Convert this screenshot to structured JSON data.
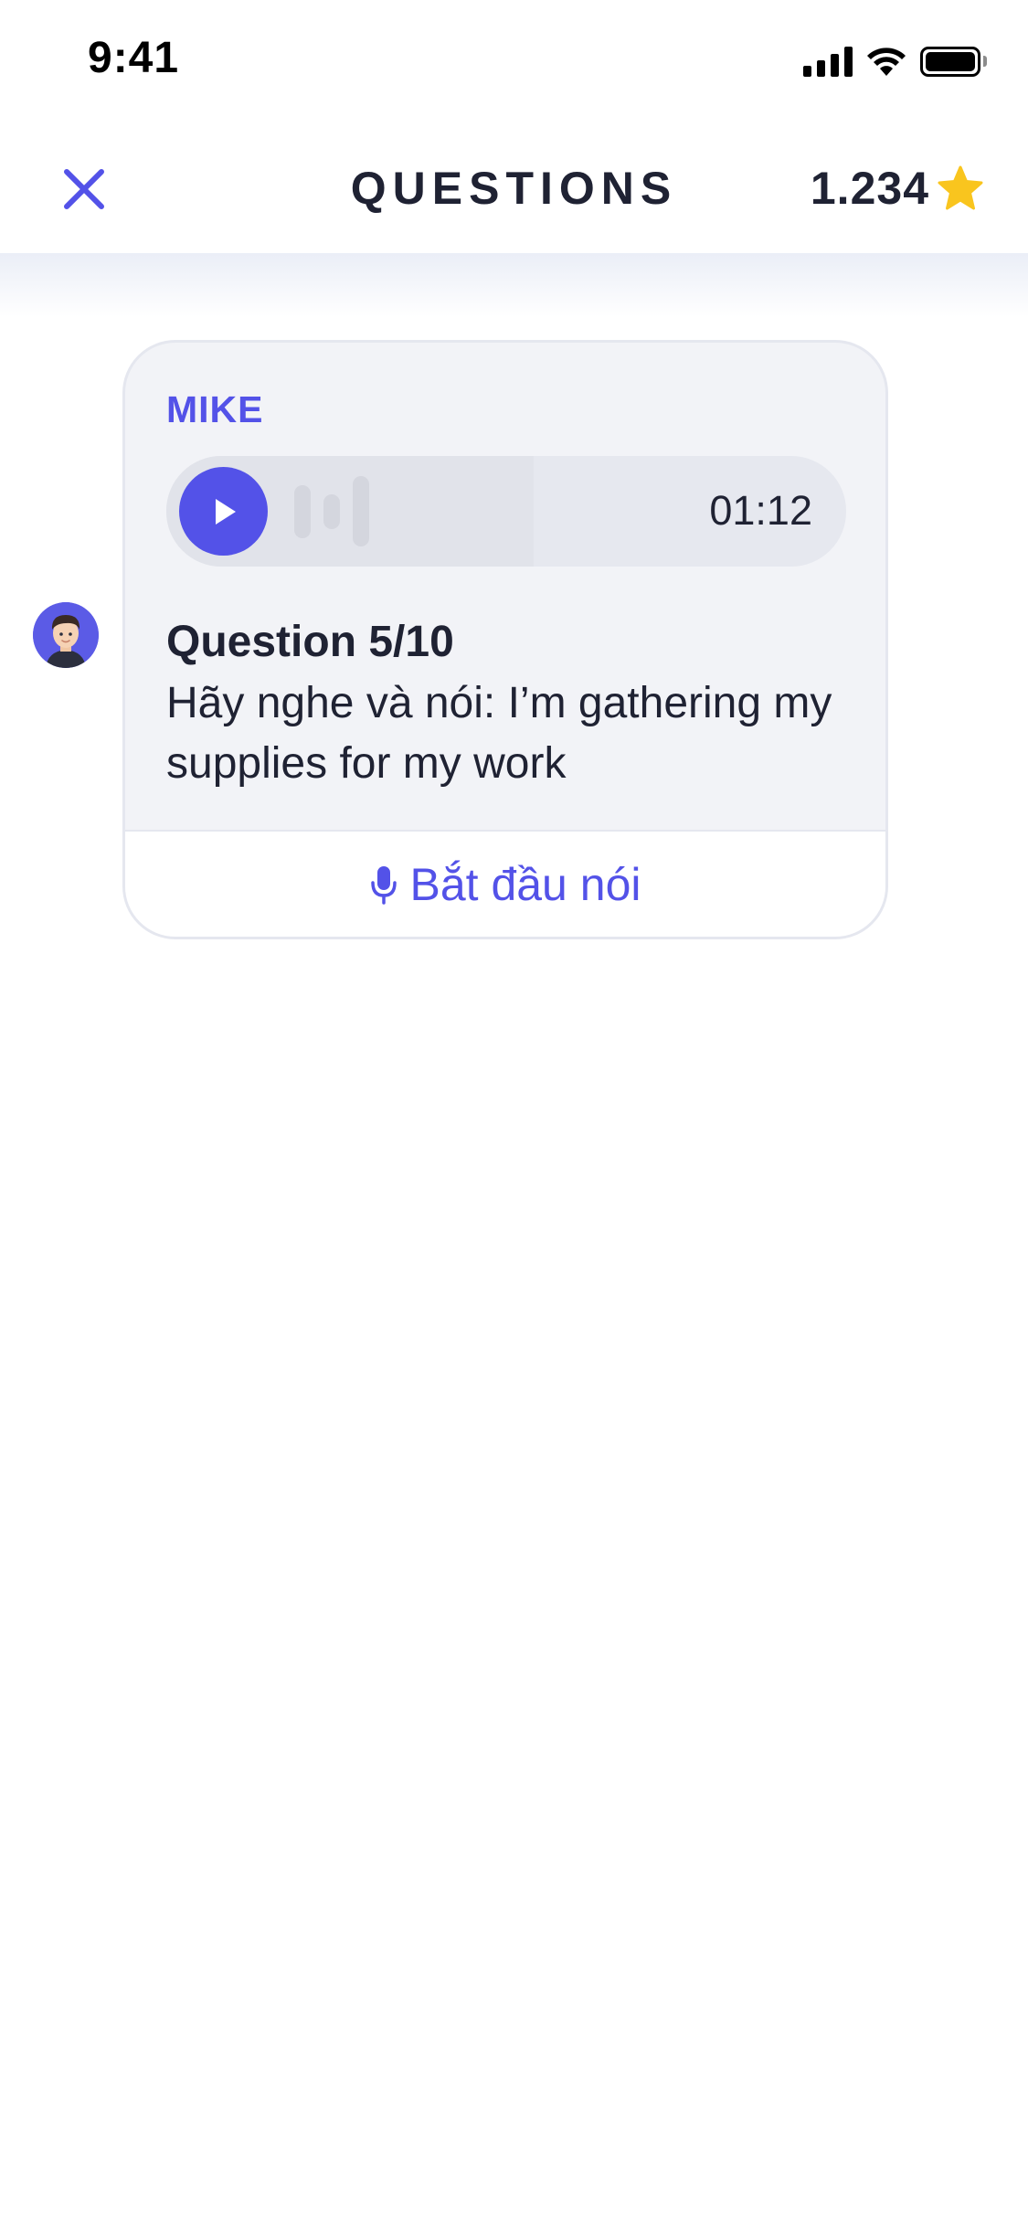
{
  "status_bar": {
    "time": "9:41"
  },
  "header": {
    "title": "QUESTIONS",
    "score": "1.234",
    "icons": {
      "close": "close-icon",
      "star": "star-icon"
    }
  },
  "colors": {
    "accent": "#5352e8",
    "star": "#f9c51e",
    "card_background": "#f2f3f7",
    "text": "#1f2233"
  },
  "message": {
    "sender": "MIKE",
    "audio": {
      "duration": "01:12",
      "progress": 0.54,
      "play_icon": "play-icon"
    },
    "question_title": "Question 5/10",
    "question_text": "Hãy nghe và nói: I’m gathering my supplies for my work",
    "speak_button_label": "Bắt đầu nói",
    "speak_icon": "microphone-icon"
  }
}
